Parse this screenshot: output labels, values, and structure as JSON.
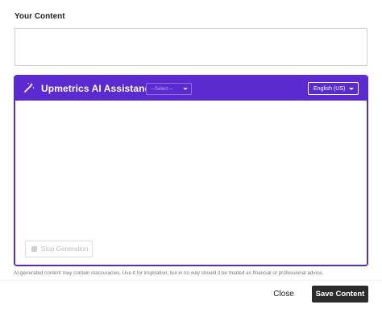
{
  "content": {
    "label": "Your Content",
    "value": "",
    "placeholder": ""
  },
  "ai_panel": {
    "title": "Upmetrics AI Assistance",
    "title_icon": "magic-wand-icon",
    "select": {
      "selected": "---Select---"
    },
    "language": {
      "selected": "English (US)"
    },
    "stop_button_label": "Stop Generation",
    "stop_icon": "stop-square-icon",
    "accent_color": "#5b2bd0"
  },
  "disclaimer": "AI-generated content may contain inaccuracies. Use it for inspiration, but in no way should it be treated as financial or professional advice.",
  "footer": {
    "close_label": "Close",
    "save_label": "Save Content"
  }
}
